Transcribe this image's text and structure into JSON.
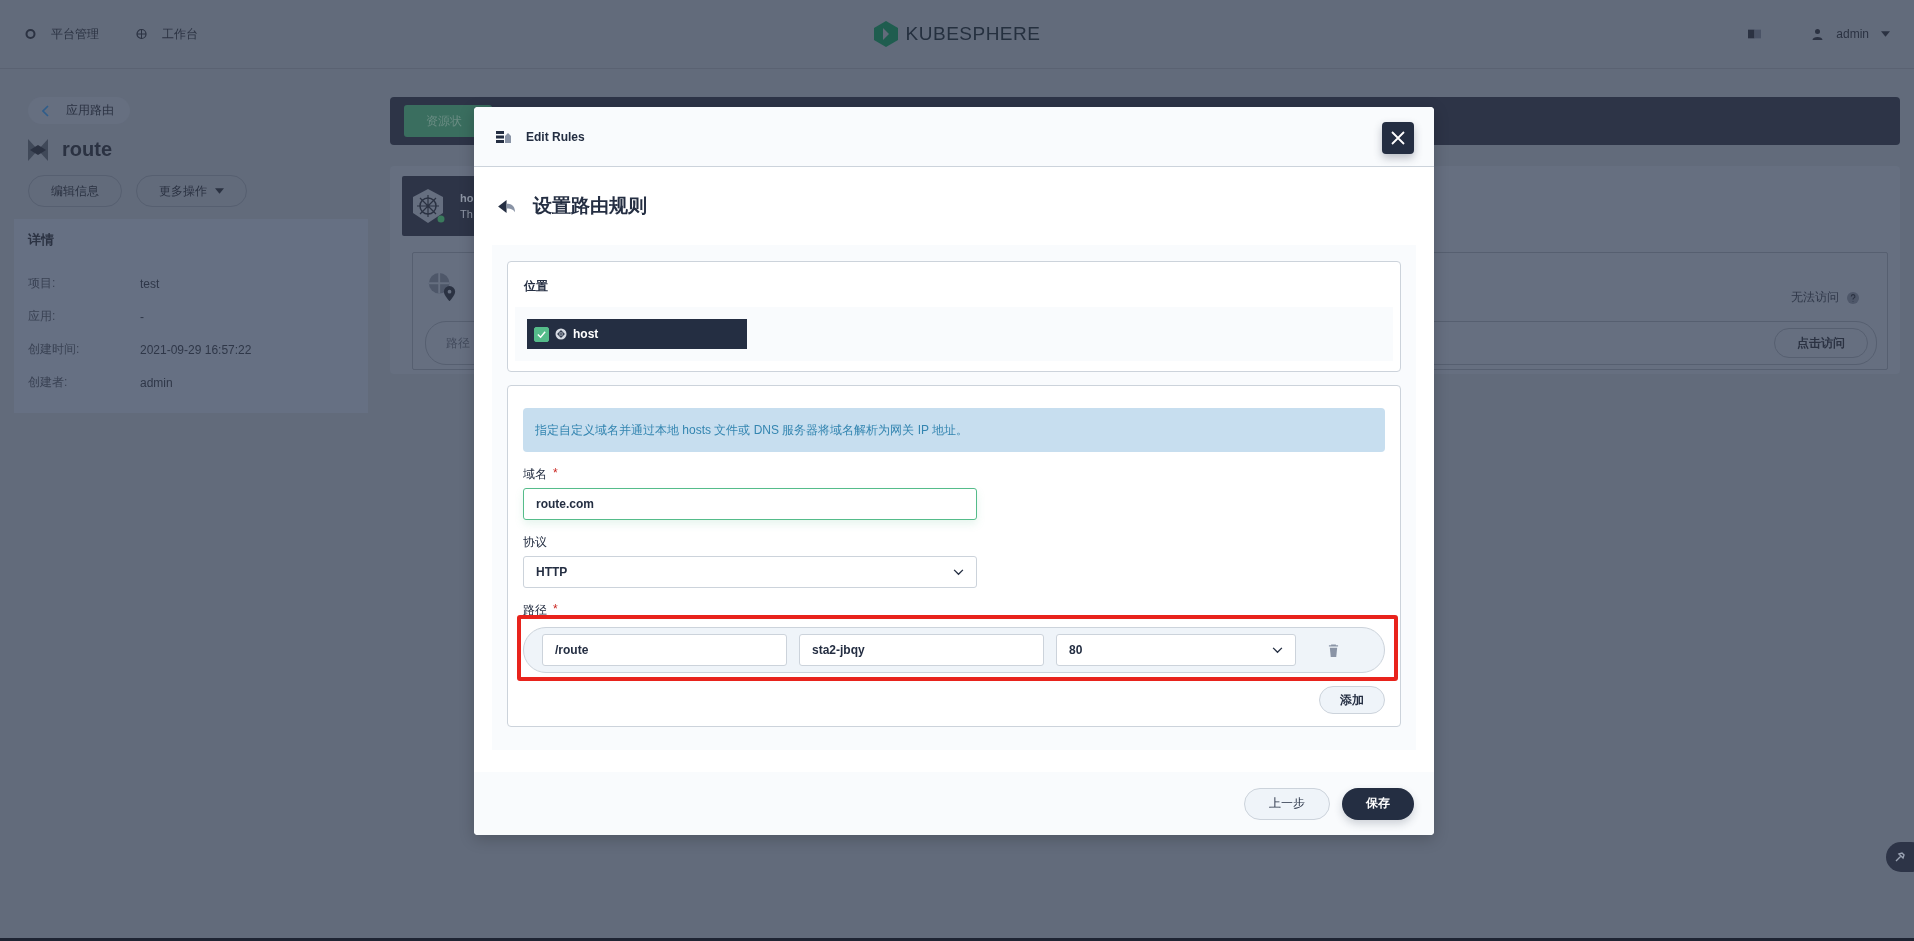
{
  "top_nav": {
    "items": [
      {
        "label": "平台管理"
      },
      {
        "label": "工作台"
      }
    ],
    "logo": "KUBESPHERE",
    "user": "admin"
  },
  "sidebar": {
    "back": "应用路由",
    "title": "route",
    "buttons": [
      "编辑信息",
      "更多操作"
    ],
    "details_title": "详情",
    "details": [
      {
        "label": "项目:",
        "value": "test"
      },
      {
        "label": "应用:",
        "value": "-"
      },
      {
        "label": "创建时间:",
        "value": "2021-09-29 16:57:22"
      },
      {
        "label": "创建者:",
        "value": "admin"
      }
    ]
  },
  "main": {
    "tab": "资源状",
    "cluster": {
      "name": "ho",
      "desc": "Th"
    },
    "route_card": {
      "path_label": "路径",
      "status": "无法访问",
      "visit_button": "点击访问"
    }
  },
  "modal": {
    "title": "Edit Rules",
    "heading": "设置路由规则",
    "location": {
      "label": "位置",
      "clusters": [
        {
          "name": "host",
          "checked": true
        }
      ]
    },
    "info": "指定自定义域名并通过本地 hosts 文件或 DNS 服务器将域名解析为网关 IP 地址。",
    "domain": {
      "label": "域名",
      "required_mark": "*",
      "value": "route.com"
    },
    "protocol": {
      "label": "协议",
      "value": "HTTP"
    },
    "paths": {
      "label": "路径",
      "required_mark": "*",
      "rules": [
        {
          "path": "/route",
          "service": "sta2-jbqy",
          "port": "80"
        }
      ],
      "add_button": "添加"
    },
    "buttons": {
      "back": "上一步",
      "save": "保存"
    }
  }
}
